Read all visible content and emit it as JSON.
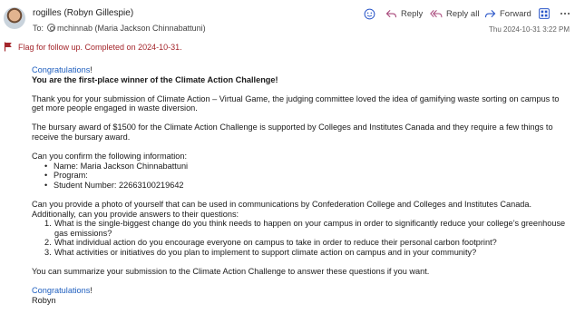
{
  "header": {
    "sender": "rogilles (Robyn Gillespie)",
    "to_label": "To:",
    "recipient": "mchinnab (Maria Jackson Chinnabattuni)",
    "date": "Thu 2024-10-31 3:22 PM",
    "actions": {
      "reply": "Reply",
      "reply_all": "Reply all",
      "forward": "Forward"
    }
  },
  "flag": {
    "text": "Flag for follow up. Completed on 2024-10-31."
  },
  "email": {
    "greeting_link": "Congratulations",
    "greeting_tail": "!",
    "headline": "You are the first-place winner of the Climate Action Challenge!",
    "para1": "Thank you for your submission of Climate Action – Virtual Game, the judging committee loved the idea of gamifying waste sorting on campus to get more people engaged in waste diversion.",
    "para2": "The bursary award of $1500 for the Climate Action Challenge is supported by Colleges and Institutes Canada and they require a few things to receive the bursary award.",
    "confirm_intro": "Can you confirm the following information:",
    "confirm_items": [
      "Name: Maria Jackson Chinnabattuni",
      "Program:",
      "Student Number: 22663100219642"
    ],
    "photo_para": "Can you provide a photo of yourself that can be used in communications by Confederation College and Colleges and Institutes Canada. Additionally, can you provide answers to their questions:",
    "questions": [
      "What is the single-biggest change do you think needs to happen on your campus in order to significantly reduce your college’s greenhouse gas emissions?",
      "What individual action do you encourage everyone on campus to take in order to reduce their personal carbon footprint?",
      "What activities or initiatives do you plan to implement to support climate action on campus and in your community?"
    ],
    "summary_para": "You can summarize your submission to the Climate Action Challenge to answer these questions if you want.",
    "closing_link": "Congratulations",
    "closing_tail": "!",
    "signature": "Robyn"
  },
  "colors": {
    "link": "#1f5fbf",
    "flag": "#a4262c",
    "accent": "#2b57c9"
  }
}
